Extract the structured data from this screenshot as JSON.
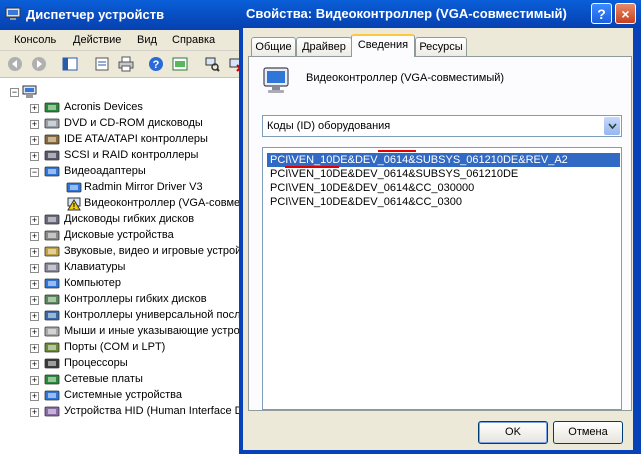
{
  "devmgr": {
    "title": "Диспетчер устройств",
    "menu": [
      "Консоль",
      "Действие",
      "Вид",
      "Справка"
    ],
    "toolbar_icons": [
      "back-arrow-icon",
      "forward-arrow-icon",
      "tree-view-icon",
      "properties-icon",
      "print-icon",
      "help-icon",
      "view-icon",
      "scan-hardware-icon",
      "uninstall-icon"
    ],
    "tree": [
      {
        "label": "Acronis Devices",
        "icon": "device-icon",
        "expander": "+",
        "level": 1
      },
      {
        "label": "DVD и CD-ROM дисководы",
        "icon": "cdrom-icon",
        "expander": "+",
        "level": 1
      },
      {
        "label": "IDE ATA/ATAPI контроллеры",
        "icon": "ide-icon",
        "expander": "+",
        "level": 1
      },
      {
        "label": "SCSI и RAID контроллеры",
        "icon": "scsi-icon",
        "expander": "+",
        "level": 1
      },
      {
        "label": "Видеоадаптеры",
        "icon": "monitor-icon",
        "expander": "−",
        "level": 1
      },
      {
        "label": "Radmin Mirror Driver V3",
        "icon": "monitor-icon",
        "expander": "",
        "level": 2
      },
      {
        "label": "Видеоконтроллер (VGA-совместимый)",
        "icon": "warning-icon",
        "expander": "",
        "level": 2
      },
      {
        "label": "Дисководы гибких дисков",
        "icon": "floppy-icon",
        "expander": "+",
        "level": 1
      },
      {
        "label": "Дисковые устройства",
        "icon": "disk-icon",
        "expander": "+",
        "level": 1
      },
      {
        "label": "Звуковые, видео и игровые устройства",
        "icon": "sound-icon",
        "expander": "+",
        "level": 1
      },
      {
        "label": "Клавиатуры",
        "icon": "keyboard-icon",
        "expander": "+",
        "level": 1
      },
      {
        "label": "Компьютер",
        "icon": "computer-icon",
        "expander": "+",
        "level": 1
      },
      {
        "label": "Контроллеры гибких дисков",
        "icon": "floppy-controller-icon",
        "expander": "+",
        "level": 1
      },
      {
        "label": "Контроллеры универсальной последовательной шины USB",
        "icon": "usb-icon",
        "expander": "+",
        "level": 1
      },
      {
        "label": "Мыши и иные указывающие устройства",
        "icon": "mouse-icon",
        "expander": "+",
        "level": 1
      },
      {
        "label": "Порты (COM и LPT)",
        "icon": "port-icon",
        "expander": "+",
        "level": 1
      },
      {
        "label": "Процессоры",
        "icon": "cpu-icon",
        "expander": "+",
        "level": 1
      },
      {
        "label": "Сетевые платы",
        "icon": "network-icon",
        "expander": "+",
        "level": 1
      },
      {
        "label": "Системные устройства",
        "icon": "system-icon",
        "expander": "+",
        "level": 1
      },
      {
        "label": "Устройства HID (Human Interface Devices)",
        "icon": "hid-icon",
        "expander": "+",
        "level": 1
      }
    ]
  },
  "dialog": {
    "title": "Свойства: Видеоконтроллер (VGA-совместимый)",
    "help_label": "?",
    "close_label": "×",
    "tabs": [
      "Общие",
      "Драйвер",
      "Сведения",
      "Ресурсы"
    ],
    "active_tab": "Сведения",
    "device_name": "Видеоконтроллер (VGA-совместимый)",
    "property_select": {
      "value": "Коды (ID) оборудования"
    },
    "hardware_ids": [
      "PCI\\VEN_10DE&DEV_0614&SUBSYS_061210DE&REV_A2",
      "PCI\\VEN_10DE&DEV_0614&SUBSYS_061210DE",
      "PCI\\VEN_10DE&DEV_0614&CC_030000",
      "PCI\\VEN_10DE&DEV_0614&CC_0300"
    ],
    "selected_index": 0,
    "ok_label": "OK",
    "cancel_label": "Отмена"
  },
  "colors": {
    "titlebar": "#0850c6",
    "selection": "#316ac5",
    "annotation": "#e00000",
    "window_bg": "#ece9d8"
  }
}
